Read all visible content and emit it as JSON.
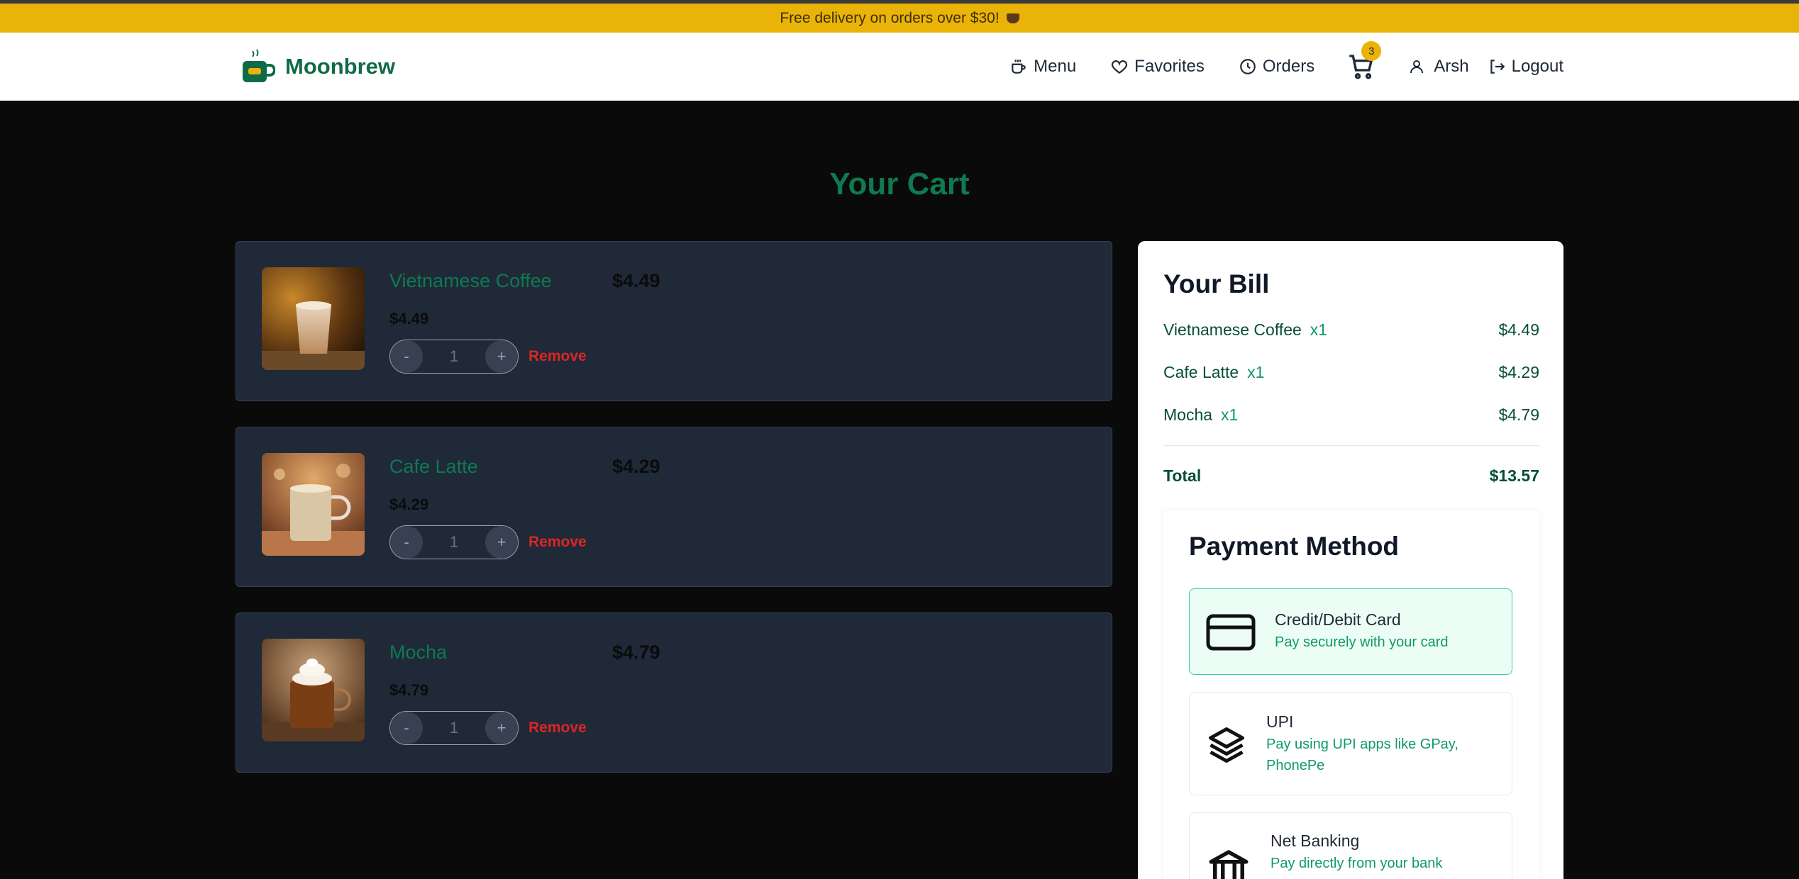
{
  "promo": {
    "text": "Free delivery on orders over $30!"
  },
  "brand": {
    "name": "Moonbrew"
  },
  "nav": {
    "menu": "Menu",
    "favorites": "Favorites",
    "orders": "Orders",
    "cart_count": "3",
    "user": "Arsh",
    "logout": "Logout"
  },
  "page_title": "Your Cart",
  "cart_items": [
    {
      "name": "Vietnamese Coffee",
      "price": "$4.49",
      "unit_price": "$4.49",
      "qty": "1",
      "minus": "-",
      "plus": "+",
      "remove": "Remove"
    },
    {
      "name": "Cafe Latte",
      "price": "$4.29",
      "unit_price": "$4.29",
      "qty": "1",
      "minus": "-",
      "plus": "+",
      "remove": "Remove"
    },
    {
      "name": "Mocha",
      "price": "$4.79",
      "unit_price": "$4.79",
      "qty": "1",
      "minus": "-",
      "plus": "+",
      "remove": "Remove"
    }
  ],
  "bill": {
    "title": "Your Bill",
    "rows": [
      {
        "name": "Vietnamese Coffee",
        "qty": "x1",
        "amount": "$4.49"
      },
      {
        "name": "Cafe Latte",
        "qty": "x1",
        "amount": "$4.29"
      },
      {
        "name": "Mocha",
        "qty": "x1",
        "amount": "$4.79"
      }
    ],
    "total_label": "Total",
    "total_value": "$13.57"
  },
  "payment": {
    "title": "Payment Method",
    "options": [
      {
        "title": "Credit/Debit Card",
        "subtitle": "Pay securely with your card",
        "selected": true
      },
      {
        "title": "UPI",
        "subtitle": "Pay using UPI apps like GPay, PhonePe",
        "selected": false
      },
      {
        "title": "Net Banking",
        "subtitle": "Pay directly from your bank",
        "selected": false
      }
    ]
  },
  "colors": {
    "brand_green": "#0f7a52",
    "promo_yellow": "#eab308",
    "remove_red": "#dc2626",
    "card_bg": "#1f2937"
  }
}
